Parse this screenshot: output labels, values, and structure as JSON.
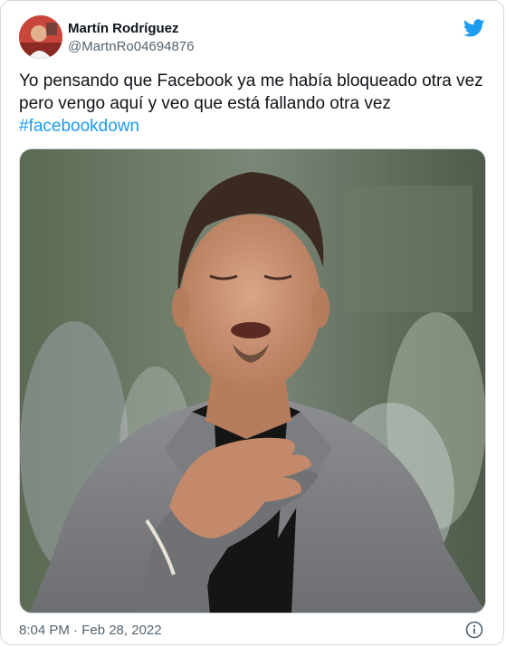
{
  "tweet": {
    "author_name": "Martín Rodríguez",
    "author_handle": "@MartnRo04694876",
    "text": "Yo pensando que Facebook ya me había bloqueado otra vez pero vengo aquí y veo que está fallando otra vez",
    "hashtag": "#facebookdown",
    "timestamp": "8:04 PM · Feb 28, 2022"
  },
  "icons": {
    "brand": "twitter-bird-icon",
    "info": "info-icon"
  },
  "colors": {
    "link": "#1d9bf0",
    "secondary_text": "#536471",
    "border": "#cfd9de"
  }
}
